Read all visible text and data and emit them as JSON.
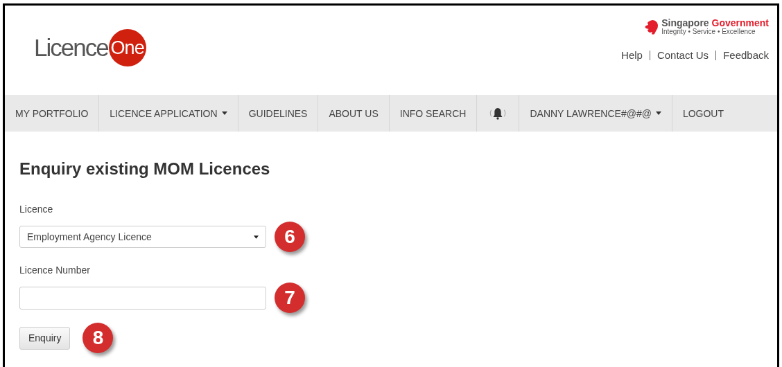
{
  "header": {
    "logo": {
      "word": "Licence",
      "mark": "One"
    },
    "government": {
      "name_part_1": "Singapore",
      "name_part_2": "Government",
      "tagline": "Integrity • Service • Excellence"
    },
    "links": [
      "Help",
      "Contact Us",
      "Feedback"
    ]
  },
  "nav": [
    {
      "kind": "link",
      "label": "MY PORTFOLIO"
    },
    {
      "kind": "dropdown",
      "label": "LICENCE APPLICATION"
    },
    {
      "kind": "link",
      "label": "GUIDELINES"
    },
    {
      "kind": "link",
      "label": "ABOUT US"
    },
    {
      "kind": "link",
      "label": "INFO SEARCH"
    },
    {
      "kind": "bell"
    },
    {
      "kind": "dropdown",
      "label": "DANNY LAWRENCE#@#@"
    },
    {
      "kind": "link",
      "label": "LOGOUT"
    }
  ],
  "title": "Enquiry existing MOM Licences",
  "form": {
    "licence_label": "Licence",
    "licence_value": "Employment Agency Licence",
    "licence_step": "6",
    "number_label": "Licence Number",
    "number_step": "7",
    "button": "Enquiry",
    "button_step": "8"
  }
}
